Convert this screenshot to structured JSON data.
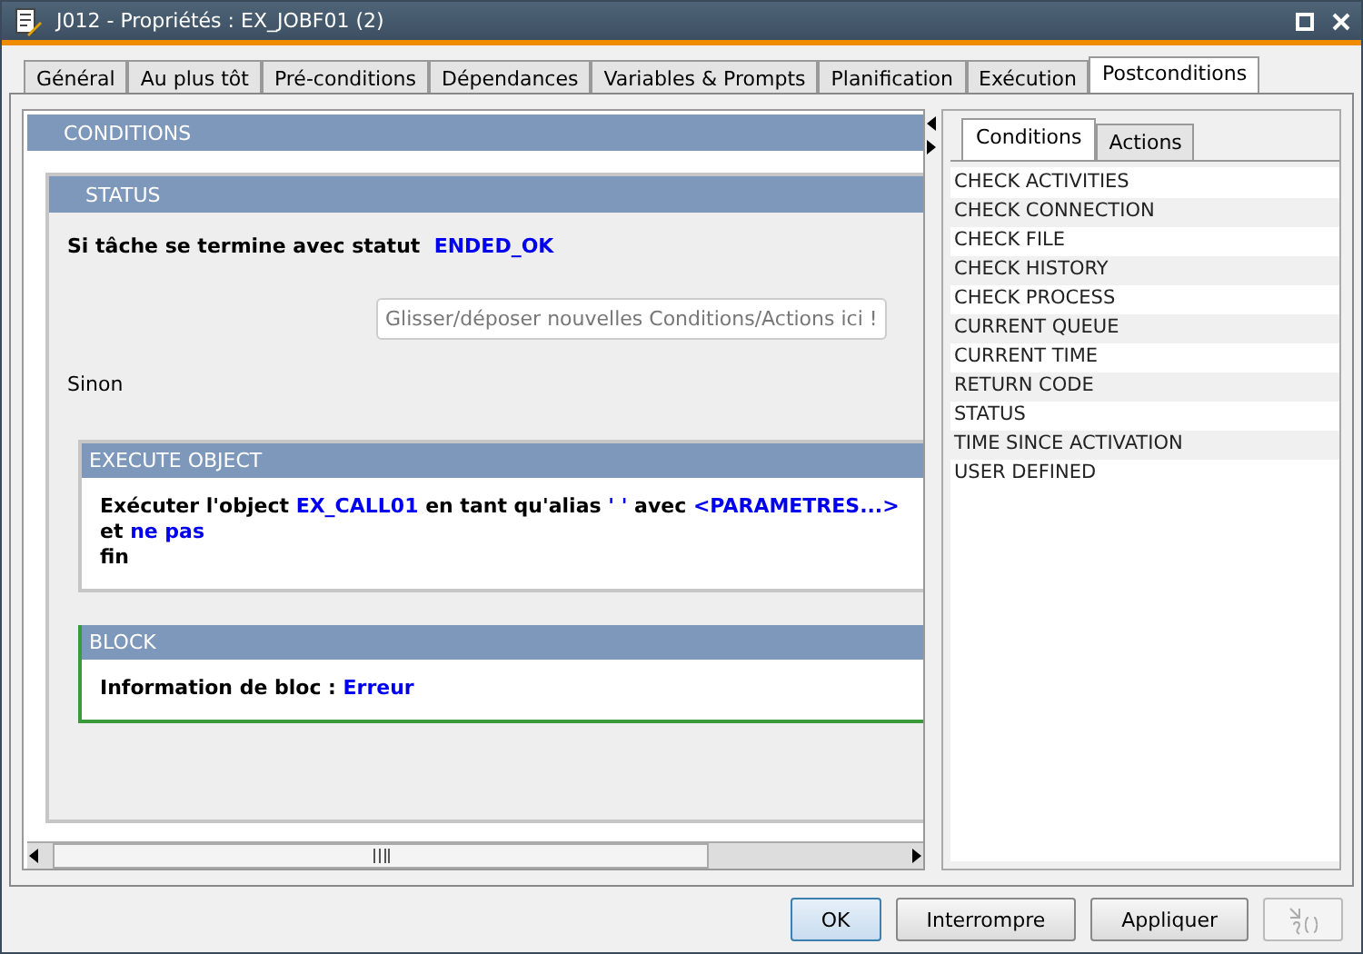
{
  "window": {
    "title": "J012 - Propriétés : EX_JOBF01 (2)"
  },
  "tabs": [
    {
      "label": "Général",
      "selected": false
    },
    {
      "label": "Au plus tôt",
      "selected": false
    },
    {
      "label": "Pré-conditions",
      "selected": false
    },
    {
      "label": "Dépendances",
      "selected": false
    },
    {
      "label": "Variables & Prompts",
      "selected": false
    },
    {
      "label": "Planification",
      "selected": false
    },
    {
      "label": "Exécution",
      "selected": false
    },
    {
      "label": "Postconditions",
      "selected": true
    }
  ],
  "conditions": {
    "title": "CONDITIONS",
    "status": {
      "title": "STATUS",
      "label": "Si tâche se termine avec statut",
      "value": "ENDED_OK",
      "drop_hint": "Glisser/déposer nouvelles Conditions/Actions ici !",
      "else_label": "Sinon"
    },
    "execute_object": {
      "title": "EXECUTE OBJECT",
      "lines": [
        [
          {
            "kind": "plain",
            "text": "Exécuter l'object "
          },
          {
            "kind": "value",
            "text": "EX_CALL01"
          },
          {
            "kind": "plain",
            "text": " en tant qu'alias "
          },
          {
            "kind": "value",
            "text": "' '"
          },
          {
            "kind": "plain",
            "text": " avec "
          },
          {
            "kind": "value",
            "text": "<PARAMETRES...>"
          },
          {
            "kind": "plain",
            "text": " et "
          },
          {
            "kind": "value",
            "text": "ne pas"
          }
        ],
        [
          {
            "kind": "plain",
            "text": "fin"
          }
        ]
      ]
    },
    "block": {
      "title": "BLOCK",
      "label": "Information de bloc :",
      "value": "Erreur"
    }
  },
  "side_tabs": [
    {
      "label": "Conditions",
      "selected": true
    },
    {
      "label": "Actions",
      "selected": false
    }
  ],
  "side_items": [
    "CHECK ACTIVITIES",
    "CHECK CONNECTION",
    "CHECK FILE",
    "CHECK HISTORY",
    "CHECK PROCESS",
    "CURRENT QUEUE",
    "CURRENT TIME",
    "RETURN CODE",
    "STATUS",
    "TIME SINCE ACTIVATION",
    "USER DEFINED"
  ],
  "buttons": [
    {
      "label": "OK",
      "kind": "default"
    },
    {
      "label": "Interrompre",
      "kind": "normal"
    },
    {
      "label": "Appliquer",
      "kind": "normal"
    }
  ]
}
